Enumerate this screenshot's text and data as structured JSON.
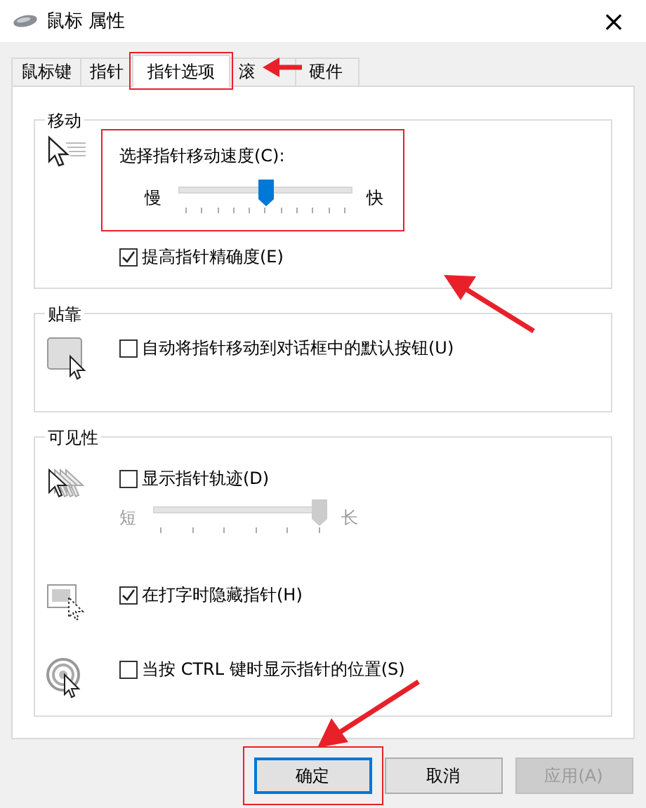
{
  "window": {
    "title": "鼠标 属性",
    "close": "×"
  },
  "tabs": [
    {
      "label": "鼠标键",
      "selected": false,
      "highlighted": false
    },
    {
      "label": "指针",
      "selected": false,
      "highlighted": false
    },
    {
      "label": "指针选项",
      "selected": true,
      "highlighted": true
    },
    {
      "label": "滚",
      "selected": false,
      "highlighted": false
    },
    {
      "label": "硬件",
      "selected": false,
      "highlighted": false
    }
  ],
  "groups": [
    {
      "title": "移动",
      "rows": [
        {
          "controls": [
            {
              "kind": "speed-slider",
              "label": "选择指针移动速度(C):",
              "min_label": "慢",
              "max_label": "快",
              "level": 0.5,
              "disabled": false,
              "highlighted": true
            },
            {
              "kind": "checkbox",
              "label": "提高指针精确度(E)",
              "checked": true
            }
          ]
        }
      ]
    },
    {
      "title": "贴靠",
      "rows": [
        {
          "controls": [
            {
              "kind": "checkbox",
              "label": "自动将指针移动到对话框中的默认按钮(U)",
              "checked": false
            }
          ]
        }
      ]
    },
    {
      "title": "可见性",
      "rows": [
        {
          "controls": [
            {
              "kind": "checkbox",
              "label": "显示指针轨迹(D)",
              "checked": false
            },
            {
              "kind": "trail-slider",
              "min_label": "短",
              "max_label": "长",
              "level": 1,
              "disabled": true
            }
          ]
        },
        {
          "controls": [
            {
              "kind": "checkbox",
              "label": "在打字时隐藏指针(H)",
              "checked": true
            }
          ]
        },
        {
          "controls": [
            {
              "kind": "checkbox",
              "label": "当按 CTRL 键时显示指针的位置(S)",
              "checked": false
            }
          ]
        }
      ]
    }
  ],
  "buttons": [
    {
      "label": "确定",
      "default": true,
      "disabled": false,
      "highlighted": true
    },
    {
      "label": "取消",
      "default": false,
      "disabled": false,
      "highlighted": false
    },
    {
      "label": "应用(A)",
      "default": false,
      "disabled": true,
      "highlighted": false
    }
  ]
}
